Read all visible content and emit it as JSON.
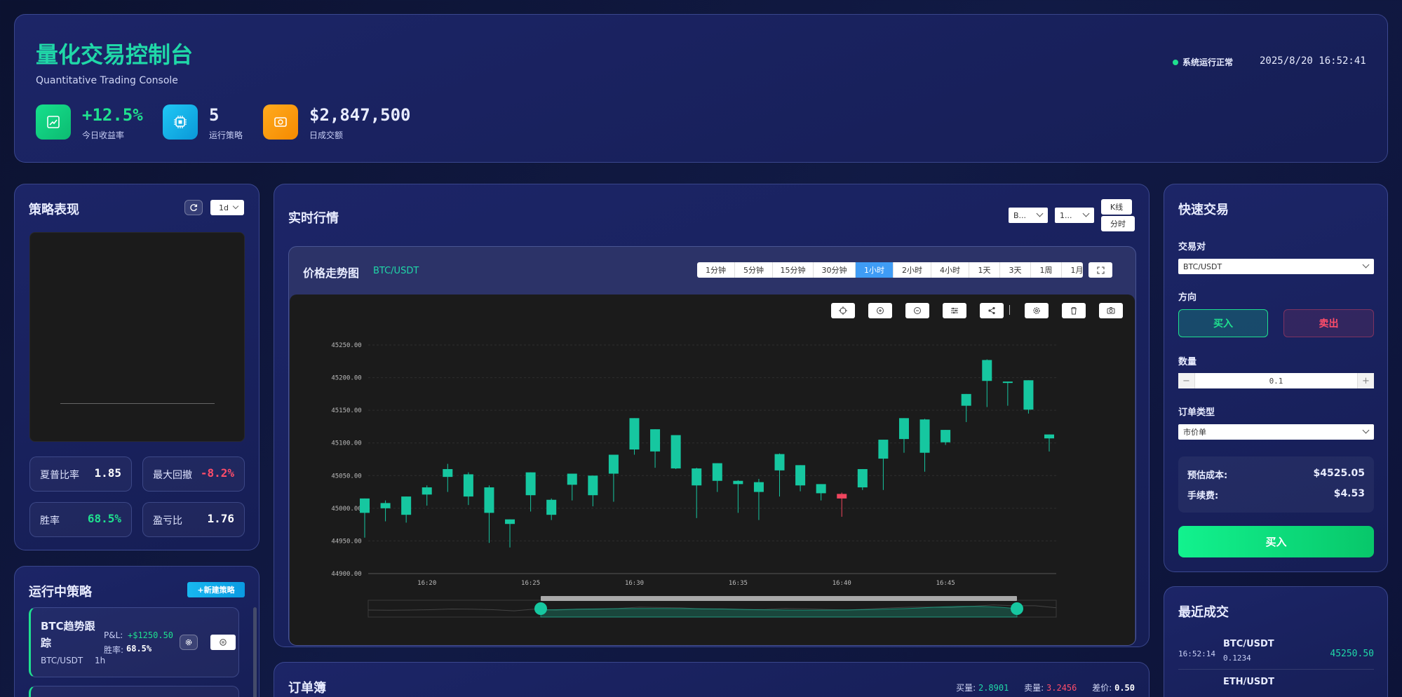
{
  "header": {
    "title": "量化交易控制台",
    "subtitle": "Quantitative Trading Console",
    "status": "系统运行正常",
    "datetime": "2025/8/20 16:52:41",
    "stats": [
      {
        "value": "+12.5%",
        "label": "今日收益率",
        "icon": "trend-chart-icon",
        "color": "#1fe08f"
      },
      {
        "value": "5",
        "label": "运行策略",
        "icon": "cpu-chip-icon",
        "color": "#ffffff"
      },
      {
        "value": "$2,847,500",
        "label": "日成交额",
        "icon": "cash-icon",
        "color": "#ffffff"
      }
    ]
  },
  "strategy_perf": {
    "title": "策略表现",
    "period": "1d",
    "metrics": [
      {
        "label": "夏普比率",
        "value": "1.85",
        "color": "#ffffff"
      },
      {
        "label": "最大回撤",
        "value": "-8.2%",
        "color": "#ff4d6a"
      },
      {
        "label": "胜率",
        "value": "68.5%",
        "color": "#1fe08f"
      },
      {
        "label": "盈亏比",
        "value": "1.76",
        "color": "#ffffff"
      }
    ]
  },
  "running": {
    "title": "运行中策略",
    "new_button": "+新建策略",
    "items": [
      {
        "name": "BTC趋势跟踪",
        "pair": "BTC/USDT",
        "interval": "1h",
        "pnl_label": "P&L:",
        "pnl": "+$1250.50",
        "winrate_label": "胜率:",
        "winrate": "68.5%"
      }
    ]
  },
  "market": {
    "title": "实时行情",
    "symbol_select": "B...",
    "interval_select": "1...",
    "view_kline": "K线",
    "view_time": "分时",
    "chart_title": "价格走势图",
    "chart_pair": "BTC/USDT",
    "timeframes": [
      "1分钟",
      "5分钟",
      "15分钟",
      "30分钟",
      "1小时",
      "2小时",
      "4小时",
      "1天",
      "3天",
      "1周",
      "1月"
    ],
    "active_timeframe": "1小时",
    "tools": [
      "crosshair-icon",
      "zoom-in-icon",
      "zoom-out-icon",
      "indicator-icon",
      "share-icon",
      "settings-icon",
      "delete-icon",
      "camera-icon"
    ]
  },
  "chart_data": {
    "type": "candlestick",
    "title": "",
    "ylim": [
      44900,
      45250
    ],
    "yticks": [
      "45250.00",
      "45200.00",
      "45150.00",
      "45100.00",
      "45050.00",
      "45000.00",
      "44950.00",
      "44900.00"
    ],
    "xticks": [
      "16:20",
      "16:25",
      "16:30",
      "16:35",
      "16:40",
      "16:45"
    ],
    "up_color": "#16c7a0",
    "down_color": "#f0455e",
    "grid": true,
    "candles": [
      {
        "t": "16:17",
        "o": 44993,
        "h": 45010,
        "l": 44955,
        "c": 45015
      },
      {
        "t": "16:18",
        "o": 45000,
        "h": 45012,
        "l": 44980,
        "c": 45008
      },
      {
        "t": "16:19",
        "o": 44990,
        "h": 45017,
        "l": 44978,
        "c": 45018
      },
      {
        "t": "16:20",
        "o": 45021,
        "h": 45035,
        "l": 45004,
        "c": 45032
      },
      {
        "t": "16:21",
        "o": 45048,
        "h": 45068,
        "l": 45025,
        "c": 45060
      },
      {
        "t": "16:22",
        "o": 45018,
        "h": 45055,
        "l": 45005,
        "c": 45052
      },
      {
        "t": "16:23",
        "o": 44993,
        "h": 45035,
        "l": 44947,
        "c": 45032
      },
      {
        "t": "16:24",
        "o": 44976,
        "h": 44983,
        "l": 44940,
        "c": 44983
      },
      {
        "t": "16:25",
        "o": 45020,
        "h": 45055,
        "l": 44995,
        "c": 45055
      },
      {
        "t": "16:26",
        "o": 44990,
        "h": 45015,
        "l": 44982,
        "c": 45013
      },
      {
        "t": "16:27",
        "o": 45036,
        "h": 45052,
        "l": 45012,
        "c": 45053
      },
      {
        "t": "16:28",
        "o": 45020,
        "h": 45050,
        "l": 45003,
        "c": 45050
      },
      {
        "t": "16:29",
        "o": 45053,
        "h": 45082,
        "l": 45010,
        "c": 45082
      },
      {
        "t": "16:30",
        "o": 45090,
        "h": 45138,
        "l": 45082,
        "c": 45138
      },
      {
        "t": "16:31",
        "o": 45087,
        "h": 45121,
        "l": 45062,
        "c": 45121
      },
      {
        "t": "16:32",
        "o": 45061,
        "h": 45112,
        "l": 45060,
        "c": 45112
      },
      {
        "t": "16:33",
        "o": 45035,
        "h": 45062,
        "l": 44985,
        "c": 45061
      },
      {
        "t": "16:34",
        "o": 45042,
        "h": 45069,
        "l": 45025,
        "c": 45069
      },
      {
        "t": "16:35",
        "o": 45037,
        "h": 45043,
        "l": 44993,
        "c": 45042
      },
      {
        "t": "16:36",
        "o": 45025,
        "h": 45045,
        "l": 44982,
        "c": 45040
      },
      {
        "t": "16:37",
        "o": 45058,
        "h": 45084,
        "l": 45018,
        "c": 45083
      },
      {
        "t": "16:38",
        "o": 45035,
        "h": 45066,
        "l": 45026,
        "c": 45066
      },
      {
        "t": "16:39",
        "o": 45023,
        "h": 45035,
        "l": 45012,
        "c": 45037
      },
      {
        "t": "16:40",
        "o": 45022,
        "h": 45024,
        "l": 44987,
        "c": 45015
      },
      {
        "t": "16:41",
        "o": 45032,
        "h": 45060,
        "l": 45028,
        "c": 45060
      },
      {
        "t": "16:42",
        "o": 45076,
        "h": 45105,
        "l": 45028,
        "c": 45105
      },
      {
        "t": "16:43",
        "o": 45106,
        "h": 45138,
        "l": 45085,
        "c": 45138
      },
      {
        "t": "16:44",
        "o": 45085,
        "h": 45137,
        "l": 45056,
        "c": 45136
      },
      {
        "t": "16:45",
        "o": 45101,
        "h": 45120,
        "l": 45097,
        "c": 45120
      },
      {
        "t": "16:46",
        "o": 45157,
        "h": 45175,
        "l": 45132,
        "c": 45175
      },
      {
        "t": "16:47",
        "o": 45195,
        "h": 45228,
        "l": 45155,
        "c": 45227
      },
      {
        "t": "16:48",
        "o": 45193,
        "h": 45193,
        "l": 45157,
        "c": 45194
      },
      {
        "t": "16:49",
        "o": 45151,
        "h": 45195,
        "l": 45145,
        "c": 45196
      },
      {
        "t": "16:50",
        "o": 45107,
        "h": 45113,
        "l": 45087,
        "c": 45113
      }
    ]
  },
  "order_book": {
    "title": "订单簿",
    "buy_label": "买量:",
    "buy_value": "2.8901",
    "sell_label": "卖量:",
    "sell_value": "3.2456",
    "spread_label": "差价:",
    "spread_value": "0.50"
  },
  "quick_trade": {
    "title": "快速交易",
    "pair_label": "交易对",
    "pair_value": "BTC/USDT",
    "direction_label": "方向",
    "buy": "买入",
    "sell": "卖出",
    "qty_label": "数量",
    "qty_value": "0.1",
    "minus": "−",
    "plus": "+",
    "order_type_label": "订单类型",
    "order_type_value": "市价单",
    "est_cost_label": "预估成本:",
    "est_cost_value": "$4525.05",
    "fee_label": "手续费:",
    "fee_value": "$4.53",
    "submit": "买入"
  },
  "recent_trades": {
    "title": "最近成交",
    "items": [
      {
        "time": "16:52:14",
        "pair": "BTC/USDT",
        "qty": "0.1234",
        "price": "45250.50"
      },
      {
        "time": "",
        "pair": "ETH/USDT",
        "qty": "",
        "price": ""
      }
    ]
  }
}
